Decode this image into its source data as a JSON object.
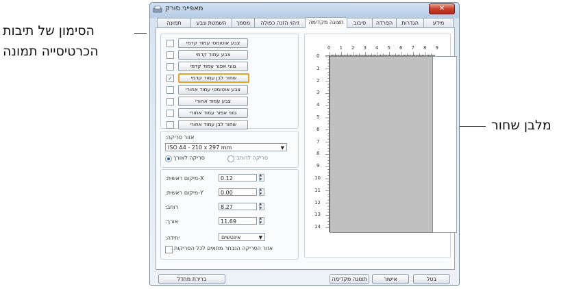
{
  "callouts": {
    "left_line1": "הסימון של תיבות",
    "left_line2": "הכרטיסייה תמונה",
    "right": "מלבן שחור"
  },
  "window": {
    "title": "מאפייני סורק",
    "close_label": "✕"
  },
  "tabs": [
    "מידע",
    "הגדרות",
    "הפרדה",
    "סיבוב",
    "תצוגה מקדימה",
    "זיהוי הזנה כפולה",
    "מסמך",
    "השמטת צבע",
    "תמונה"
  ],
  "active_tab": "תצוגה מקדימה",
  "image_options": [
    {
      "label": "צבע אוטומטי עמוד קדמי",
      "checked": false
    },
    {
      "label": "צבע עמוד קדמי",
      "checked": false
    },
    {
      "label": "גווני אפור עמוד קדמי",
      "checked": false
    },
    {
      "label": "שחור לבן עמוד קדמי",
      "checked": true,
      "selected": true
    },
    {
      "label": "צבע אוטומטי עמוד אחורי",
      "checked": false
    },
    {
      "label": "צבע עמוד אחורי",
      "checked": false
    },
    {
      "label": "גווני אפור עמוד אחורי",
      "checked": false
    },
    {
      "label": "שחור לבן עמוד אחורי",
      "checked": false
    }
  ],
  "scan_area": {
    "label": ":אזור סריקה",
    "selected": "ISO A4 - 210 x 297 mm",
    "radio_landscape": "סריקה לרוחב",
    "radio_portrait": "סריקה לאורך"
  },
  "fields": [
    {
      "label": ":מיקום ראשית-X",
      "value": "0.12"
    },
    {
      "label": ":מיקום ראשית-Y",
      "value": "0.00"
    },
    {
      "label": ":רוחב",
      "value": "8.27"
    },
    {
      "label": ":אורך",
      "value": "11.69"
    }
  ],
  "unit": {
    "label": ":יחידה",
    "value": "אינטשים"
  },
  "apply_all_label": "אזור הסריקה הנבחר מתאים לכל הסריקות",
  "ruler": {
    "h_ticks": [
      "0",
      "1",
      "2",
      "3",
      "4",
      "5",
      "6",
      "7",
      "8",
      "9"
    ],
    "v_ticks": [
      "0",
      "1",
      "2",
      "3",
      "4",
      "5",
      "6",
      "7",
      "8",
      "9",
      "10",
      "11",
      "12",
      "13",
      "14"
    ]
  },
  "buttons": {
    "defaults": "ברירת מחדל",
    "preview": "תצוגה מקדימה",
    "ok": "אישור",
    "cancel": "בטל"
  },
  "colors": {
    "scan_area_fill": "#c0c0c0",
    "selection_highlight": "#e8a12a",
    "close_button": "#c8402c"
  }
}
